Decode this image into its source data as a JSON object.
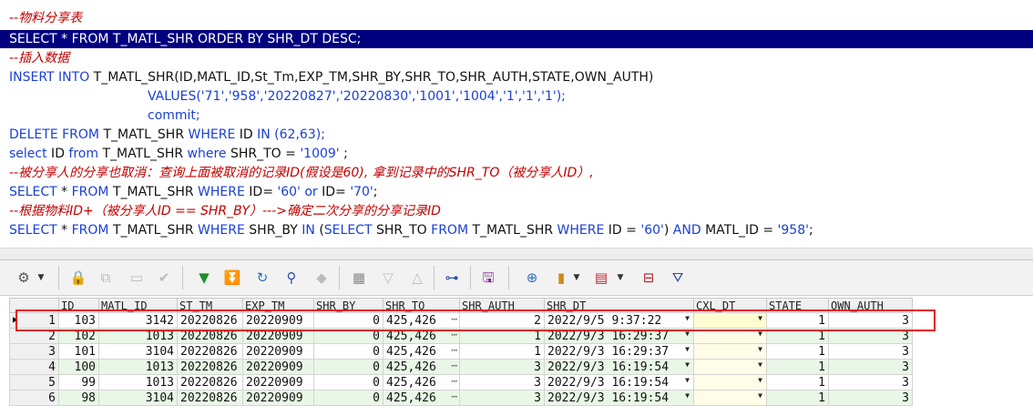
{
  "editor": {
    "line1": "--物料分享表",
    "line2": "SELECT * FROM T_MATL_SHR ORDER BY SHR_DT DESC;",
    "line3": "--插入数据",
    "line4_kw1": "INSERT INTO",
    "line4_rest": " T_MATL_SHR(ID,MATL_ID,St_Tm,EXP_TM,SHR_BY,SHR_TO,SHR_AUTH,STATE,OWN_AUTH)",
    "line5_kw": "VALUES",
    "line5_vals": "('71','958','20220827','20220830','1001','1004','1','1','1');",
    "line6": "commit;",
    "line7_kw1": "DELETE FROM",
    "line7_t": " T_MATL_SHR ",
    "line7_kw2": "WHERE",
    "line7_c": " ID ",
    "line7_kw3": "IN",
    "line7_v": " (62,63);",
    "line8_kw1": "select",
    "line8_a": " ID ",
    "line8_kw2": "from",
    "line8_b": " T_MATL_SHR ",
    "line8_kw3": "where",
    "line8_c": " SHR_TO = ",
    "line8_v": "'1009'",
    "line8_d": " ;",
    "line9": "--被分享人的分享也取消：查询上面被取消的记录ID(假设是60), 拿到记录中的SHR_TO（被分享人ID）,",
    "line10_kw1": "SELECT",
    "line10_a": " * ",
    "line10_kw2": "FROM",
    "line10_b": " T_MATL_SHR ",
    "line10_kw3": "WHERE",
    "line10_c": " ID= ",
    "line10_v1": "'60'",
    "line10_kw4": " or",
    "line10_d": " ID= ",
    "line10_v2": "'70'",
    "line10_e": ";",
    "line11": "--根据物料ID+（被分享人ID == SHR_BY）--->确定二次分享的分享记录ID",
    "line12_kw1": "SELECT",
    "line12_a": " * ",
    "line12_kw2": "FROM",
    "line12_b": " T_MATL_SHR ",
    "line12_kw3": "WHERE",
    "line12_c": " SHR_BY ",
    "line12_kw4": "IN",
    "line12_d": " (",
    "line12_kw5": "SELECT",
    "line12_e": " SHR_TO ",
    "line12_kw6": "FROM",
    "line12_f": " T_MATL_SHR ",
    "line12_kw7": "WHERE",
    "line12_g": " ID = ",
    "line12_v1": "'60'",
    "line12_h": ") ",
    "line12_kw8": "AND",
    "line12_i": " MATL_ID = ",
    "line12_v2": "'958'",
    "line12_j": ";"
  },
  "toolbar": {
    "icons": [
      "grid-options-icon",
      "lock-icon",
      "insert-record-icon",
      "delete-record-icon",
      "post-icon",
      "fetch-next-icon",
      "fetch-last-icon",
      "refresh-icon",
      "query-by-example-icon",
      "clear-icon",
      "export-icon",
      "sort-desc-icon",
      "sort-asc-icon",
      "link-icon",
      "save-icon",
      "query-icon",
      "chart-icon",
      "table-view-icon",
      "record-view-icon",
      "filter-icon"
    ]
  },
  "grid": {
    "columns": [
      "ID",
      "MATL_ID",
      "ST_TM",
      "EXP_TM",
      "SHR_BY",
      "SHR_TO",
      "SHR_AUTH",
      "SHR_DT",
      "CXL_DT",
      "STATE",
      "OWN_AUTH"
    ],
    "rows": [
      {
        "n": "1",
        "id": "103",
        "matl_id": "3142",
        "st_tm": "20220826",
        "exp_tm": "20220909",
        "shr_by": "0",
        "shr_to": "425,426",
        "shr_auth": "2",
        "shr_dt": "2022/9/5 9:37:22",
        "cxl_dt": "",
        "state": "1",
        "own_auth": "3"
      },
      {
        "n": "2",
        "id": "102",
        "matl_id": "1013",
        "st_tm": "20220826",
        "exp_tm": "20220909",
        "shr_by": "0",
        "shr_to": "425,426",
        "shr_auth": "1",
        "shr_dt": "2022/9/3 16:29:37",
        "cxl_dt": "",
        "state": "1",
        "own_auth": "3"
      },
      {
        "n": "3",
        "id": "101",
        "matl_id": "3104",
        "st_tm": "20220826",
        "exp_tm": "20220909",
        "shr_by": "0",
        "shr_to": "425,426",
        "shr_auth": "1",
        "shr_dt": "2022/9/3 16:29:37",
        "cxl_dt": "",
        "state": "1",
        "own_auth": "3"
      },
      {
        "n": "4",
        "id": "100",
        "matl_id": "1013",
        "st_tm": "20220826",
        "exp_tm": "20220909",
        "shr_by": "0",
        "shr_to": "425,426",
        "shr_auth": "3",
        "shr_dt": "2022/9/3 16:19:54",
        "cxl_dt": "",
        "state": "1",
        "own_auth": "3"
      },
      {
        "n": "5",
        "id": "99",
        "matl_id": "1013",
        "st_tm": "20220826",
        "exp_tm": "20220909",
        "shr_by": "0",
        "shr_to": "425,426",
        "shr_auth": "3",
        "shr_dt": "2022/9/3 16:19:54",
        "cxl_dt": "",
        "state": "1",
        "own_auth": "3"
      },
      {
        "n": "6",
        "id": "98",
        "matl_id": "3104",
        "st_tm": "20220826",
        "exp_tm": "20220909",
        "shr_by": "0",
        "shr_to": "425,426",
        "shr_auth": "3",
        "shr_dt": "2022/9/3 16:19:54",
        "cxl_dt": "",
        "state": "1",
        "own_auth": "3"
      }
    ]
  },
  "colors": {
    "selection": "#00007f",
    "comment": "#c00000",
    "keyword": "#1a3fd6",
    "alt_row": "#e9f7e6",
    "highlight_box": "#e02020"
  }
}
